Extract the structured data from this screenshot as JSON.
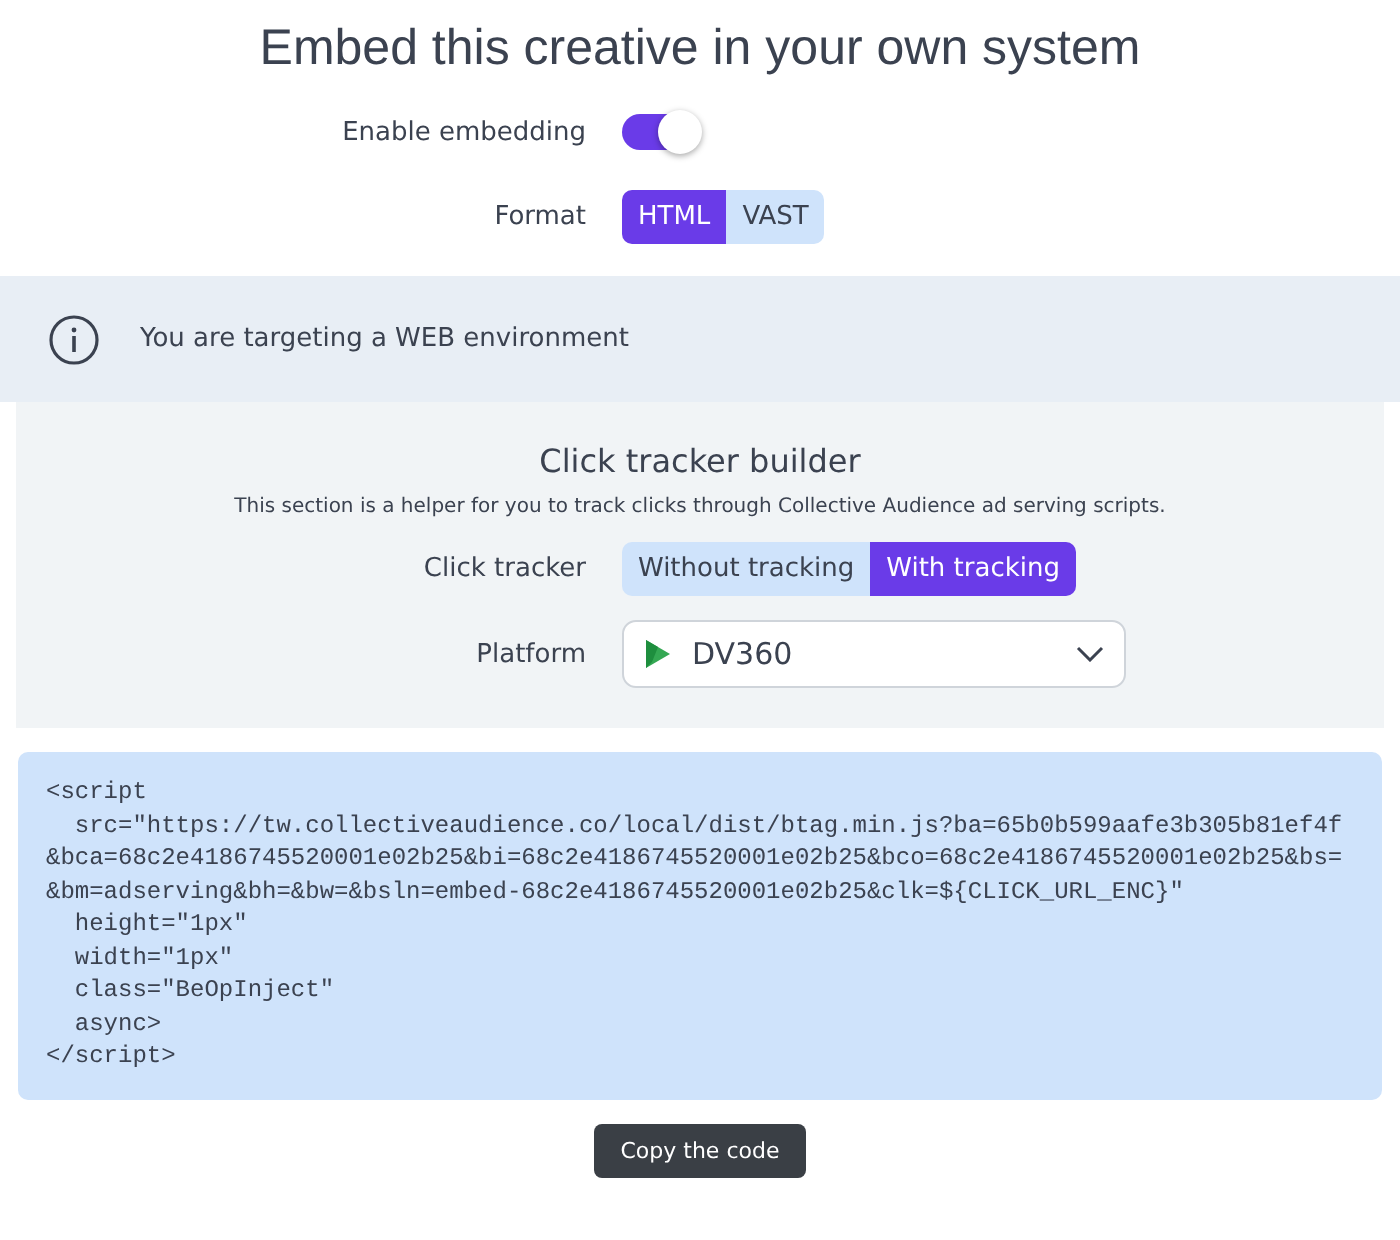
{
  "title": "Embed this creative in your own system",
  "embedding": {
    "label": "Enable embedding",
    "on": true
  },
  "format": {
    "label": "Format",
    "options": [
      {
        "label": "HTML",
        "selected": true
      },
      {
        "label": "VAST",
        "selected": false
      }
    ]
  },
  "info": {
    "text": "You are targeting a WEB environment"
  },
  "click_tracker_builder": {
    "title": "Click tracker builder",
    "description": "This section is a helper for you to track clicks through Collective Audience ad serving scripts.",
    "tracker": {
      "label": "Click tracker",
      "options": [
        {
          "label": "Without tracking",
          "selected": false
        },
        {
          "label": "With tracking",
          "selected": true
        }
      ]
    },
    "platform": {
      "label": "Platform",
      "value": "DV360"
    }
  },
  "code_lines": [
    "<script",
    "  src=\"https://tw.collectiveaudience.co/local/dist/btag.min.js?ba=65b0b599aafe3b305b81ef4f",
    "&bca=68c2e4186745520001e02b25&bi=68c2e4186745520001e02b25&bco=68c2e4186745520001e02b25&bs=",
    "&bm=adserving&bh=&bw=&bsln=embed-68c2e4186745520001e02b25&clk=${CLICK_URL_ENC}\"",
    "  height=\"1px\"",
    "  width=\"1px\"",
    "  class=\"BeOpInject\"",
    "  async>",
    "</script>"
  ],
  "copy_button": "Copy the code"
}
